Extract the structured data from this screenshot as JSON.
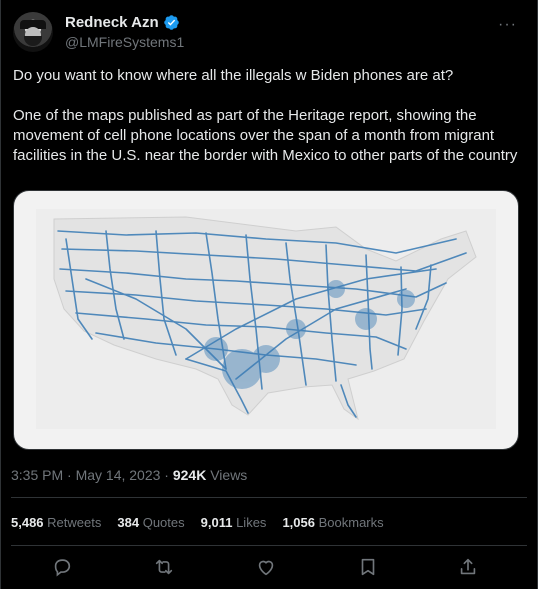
{
  "author": {
    "display_name": "Redneck Azn",
    "handle": "@LMFireSystems1",
    "verified": true
  },
  "tweet": {
    "text": "Do you want to know where all the illegals w Biden phones are at?\n\nOne of the maps published as part of the Heritage report, showing the movement of cell phone locations over the span of a month from migrant facilities in the U.S. near the border with Mexico to other parts of the country"
  },
  "meta": {
    "time": "3:35 PM · May 14, 2023 · ",
    "views_count": "924K",
    "views_label": " Views"
  },
  "stats": {
    "retweets": {
      "num": "5,486",
      "label": "Retweets"
    },
    "quotes": {
      "num": "384",
      "label": "Quotes"
    },
    "likes": {
      "num": "9,011",
      "label": "Likes"
    },
    "bookmarks": {
      "num": "1,056",
      "label": "Bookmarks"
    }
  },
  "icons": {
    "more": "more-icon",
    "verified": "verified-badge-icon",
    "reply": "reply-icon",
    "retweet": "retweet-icon",
    "like": "like-icon",
    "bookmark": "bookmark-icon",
    "share": "share-icon"
  },
  "colors": {
    "background": "#000000",
    "text": "#e7e9ea",
    "muted": "#71767b",
    "verified": "#1d9bf0",
    "map_route": "#3f7fb6"
  }
}
